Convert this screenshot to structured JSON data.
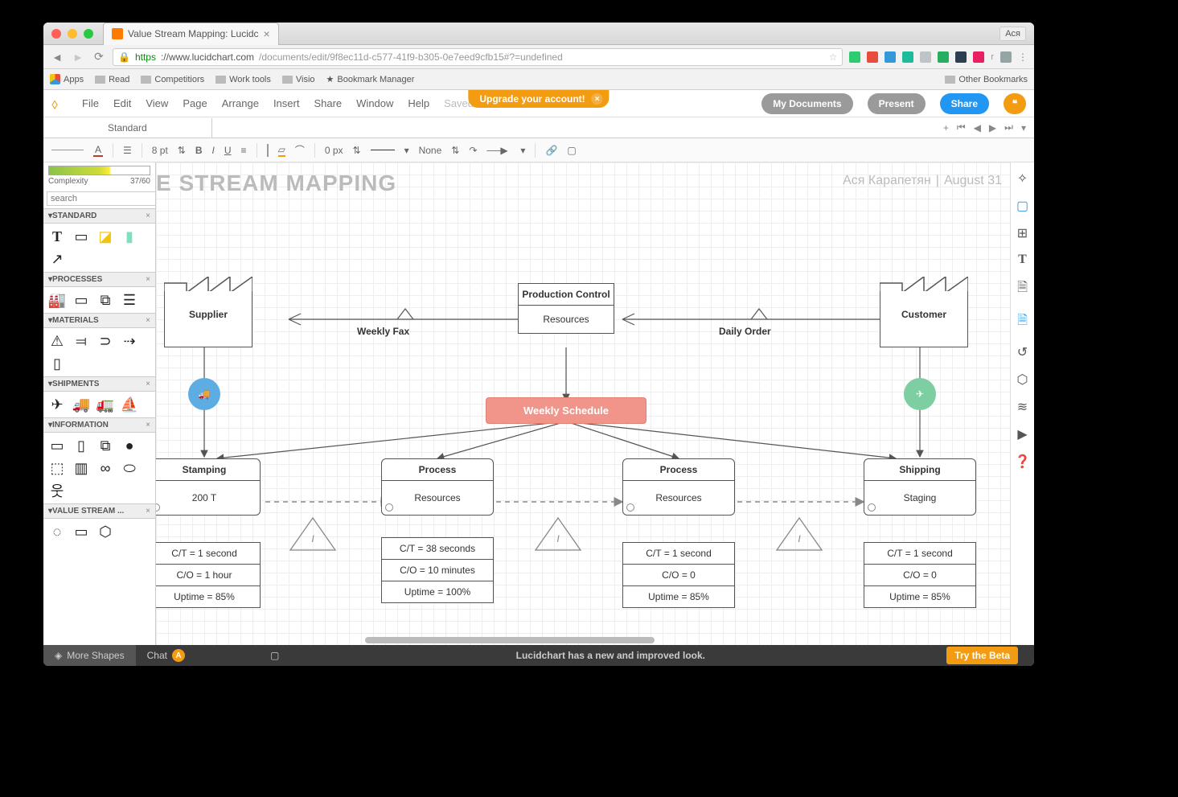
{
  "browser": {
    "tab_title": "Value Stream Mapping: Lucidc",
    "user": "Аcя",
    "url_https": "https",
    "url_host": "://www.lucidchart.com",
    "url_path": "/documents/edit/9f8ec11d-c577-41f9-b305-0e7eed9cfb15#?=undefined",
    "bookmarks": [
      "Apps",
      "Read",
      "Competitiors",
      "Work tools",
      "Visio",
      "Bookmark Manager"
    ],
    "other_bookmarks": "Other Bookmarks"
  },
  "upgrade": {
    "text": "Upgrade your account!"
  },
  "menu": {
    "items": [
      "File",
      "Edit",
      "View",
      "Page",
      "Arrange",
      "Insert",
      "Share",
      "Window",
      "Help"
    ],
    "saved": "Saved",
    "my_docs": "My Documents",
    "present": "Present",
    "share": "Share"
  },
  "doc_tab": "Standard",
  "tabbar_plus": "+",
  "toolbar": {
    "font_size": "8 pt",
    "border_px": "0 px",
    "line_style": "None"
  },
  "complexity": {
    "label": "Complexity",
    "value": "37/60"
  },
  "search_placeholder": "search",
  "sections": {
    "standard": "STANDARD",
    "processes": "PROCESSES",
    "materials": "MATERIALS",
    "shipments": "SHIPMENTS",
    "information": "INFORMATION",
    "vsm": "VALUE STREAM ..."
  },
  "document": {
    "title": "E STREAM MAPPING",
    "author": "Ася Карапетян",
    "date": "August 31"
  },
  "nodes": {
    "supplier": "Supplier",
    "customer": "Customer",
    "prod_control": {
      "title": "Production Control",
      "sub": "Resources"
    },
    "weekly_fax": "Weekly Fax",
    "daily_order": "Daily Order",
    "schedule": "Weekly Schedule",
    "proc1": {
      "title": "Stamping",
      "sub": "200 T"
    },
    "proc2": {
      "title": "Process",
      "sub": "Resources"
    },
    "proc3": {
      "title": "Process",
      "sub": "Resources"
    },
    "proc4": {
      "title": "Shipping",
      "sub": "Staging"
    },
    "data1": {
      "r1": "C/T = 1 second",
      "r2": "C/O = 1 hour",
      "r3": "Uptime = 85%"
    },
    "data2": {
      "r1": "C/T = 38 seconds",
      "r2": "C/O = 10 minutes",
      "r3": "Uptime = 100%"
    },
    "data3": {
      "r1": "C/T = 1 second",
      "r2": "C/O = 0",
      "r3": "Uptime = 85%"
    },
    "data4": {
      "r1": "C/T = 1 second",
      "r2": "C/O = 0",
      "r3": "Uptime = 85%"
    }
  },
  "footer": {
    "more_shapes": "More Shapes",
    "chat": "Chat",
    "msg": "Lucidchart has a new and improved look.",
    "beta": "Try the Beta"
  }
}
